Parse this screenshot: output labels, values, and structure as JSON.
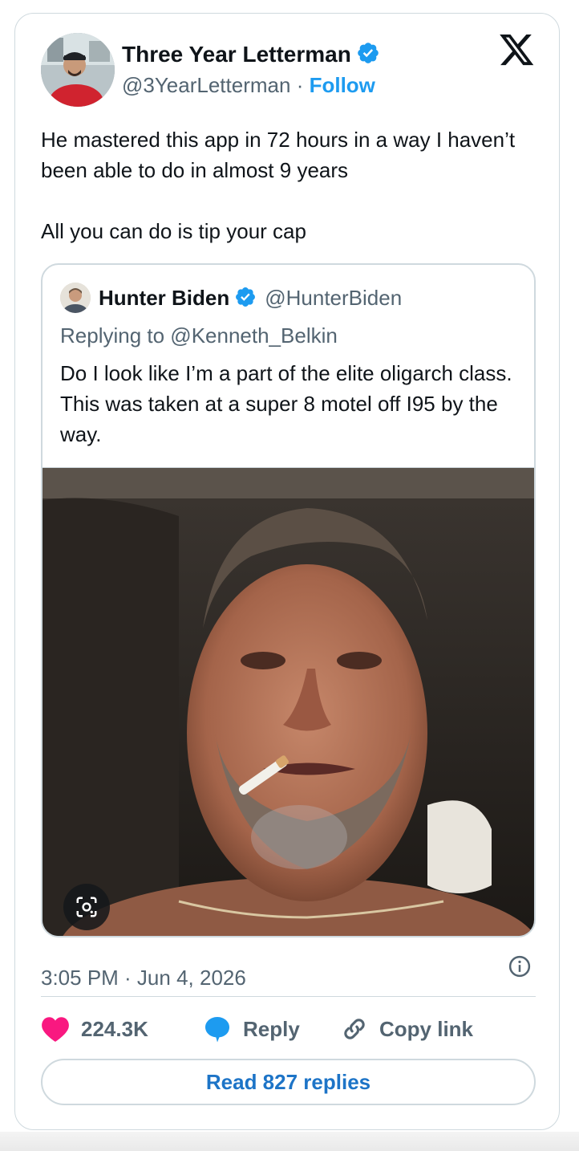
{
  "author": {
    "name": "Three Year Letterman",
    "handle": "@3YearLetterman",
    "separator": "·",
    "follow_label": "Follow",
    "verified": true
  },
  "tweet": {
    "text_lines": [
      "He mastered this app in 72 hours in a way I haven’t been able to do in almost 9 years",
      "All you can do is tip your cap"
    ],
    "timestamp": "3:05 PM · Jun 4, 2026"
  },
  "quoted_tweet": {
    "name": "Hunter Biden",
    "handle": "@HunterBiden",
    "replying_to": "Replying to @Kenneth_Belkin",
    "text": "Do I look like I’m a part of the elite oligarch class. This was taken at a super 8 motel off I95 by the way."
  },
  "actions": {
    "likes": "224.3K",
    "reply_label": "Reply",
    "copy_label": "Copy link"
  },
  "read_replies_label": "Read 827 replies",
  "icons": {
    "logo": "x-logo-icon",
    "verified": "verified-badge-icon",
    "info": "info-icon",
    "like": "heart-icon",
    "reply": "speech-bubble-icon",
    "copy": "link-icon",
    "lens": "image-search-icon"
  },
  "colors": {
    "accent": "#1d9bf0",
    "like": "#f91880",
    "muted": "#536471",
    "border": "#cfd9de"
  }
}
